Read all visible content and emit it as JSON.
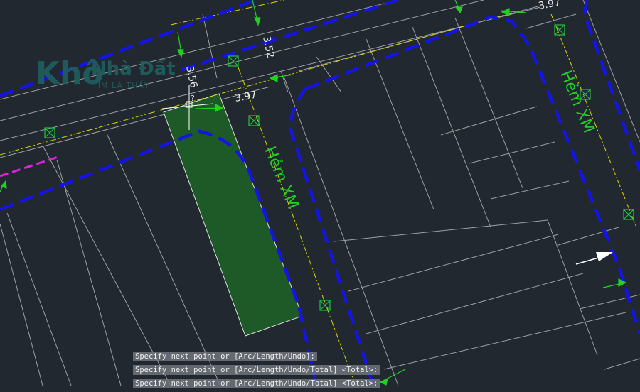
{
  "drawing": {
    "dimensions": [
      "3.52",
      "3.97",
      "3.56",
      "3.97"
    ],
    "street_labels": [
      "Hẻm XM",
      "Hẻm XM"
    ],
    "cursor_marker": "?",
    "highlight_color": "#1e5a28",
    "boundary_color": "#1414e6",
    "setback_color": "#e0e000",
    "grid_line_color": "#c8c8c8",
    "marker_color": "#22c040"
  },
  "watermark": {
    "main": "Khô",
    "middle": "Nhà Đất",
    "tagline": "TÌM LÀ THẤY"
  },
  "command_history": [
    "Specify next point or [Arc/Length/Undo]:",
    "Specify next point or [Arc/Length/Undo/Total] <Total>:",
    "Specify next point or [Arc/Length/Undo/Total] <Total>:"
  ]
}
